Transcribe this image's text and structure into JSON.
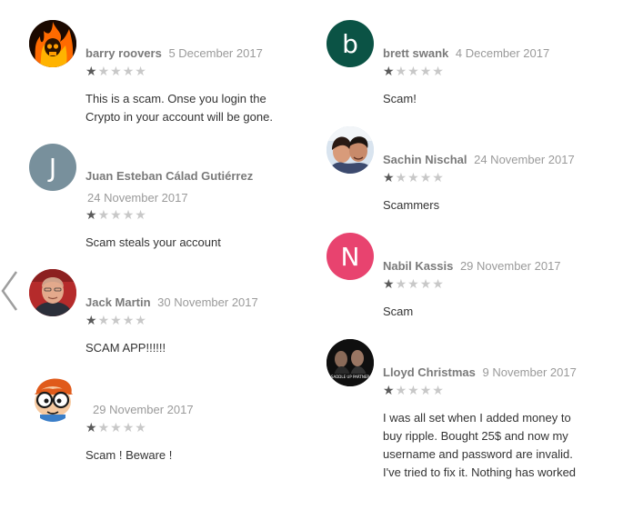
{
  "nav": {
    "prev_icon": "chevron-left-icon"
  },
  "reviews_left": [
    {
      "author": "barry roovers",
      "date": "5 December 2017",
      "rating": 1,
      "text": "This is a scam. Onse you login the Crypto in your account will be gone.",
      "avatar": {
        "type": "image",
        "icon": "flaming-skull-avatar"
      }
    },
    {
      "author": "Juan Esteban Cálad Gutiérrez",
      "date": "24 November 2017",
      "rating": 1,
      "text": "Scam steals your account",
      "avatar": {
        "type": "letter",
        "letter": "J",
        "color": "#78909c"
      }
    },
    {
      "author": "Jack Martin",
      "date": "30 November 2017",
      "rating": 1,
      "text": "SCAM APP!!!!!!",
      "avatar": {
        "type": "image",
        "icon": "bald-man-photo-avatar"
      }
    },
    {
      "author": "",
      "date": "29 November 2017",
      "rating": 1,
      "text": "Scam ! Beware !",
      "avatar": {
        "type": "image",
        "icon": "cartoon-boy-glasses-avatar"
      }
    }
  ],
  "reviews_right": [
    {
      "author": "brett swank",
      "date": "4 December 2017",
      "rating": 1,
      "text": "Scam!",
      "avatar": {
        "type": "letter",
        "letter": "b",
        "color": "#0b5345"
      }
    },
    {
      "author": "Sachin Nischal",
      "date": "24 November 2017",
      "rating": 1,
      "text": "Scammers",
      "avatar": {
        "type": "image",
        "icon": "couple-selfie-avatar"
      }
    },
    {
      "author": "Nabil Kassis",
      "date": "29 November 2017",
      "rating": 1,
      "text": "Scam",
      "avatar": {
        "type": "letter",
        "letter": "N",
        "color": "#e8436f"
      }
    },
    {
      "author": "Lloyd Christmas",
      "date": "9 November 2017",
      "rating": 1,
      "text": "I was all set when I added money to buy ripple. Bought 25$ and now my username and password are invalid. I've tried to fix it. Nothing has worked",
      "avatar": {
        "type": "image",
        "icon": "movie-poster-avatar"
      }
    }
  ]
}
